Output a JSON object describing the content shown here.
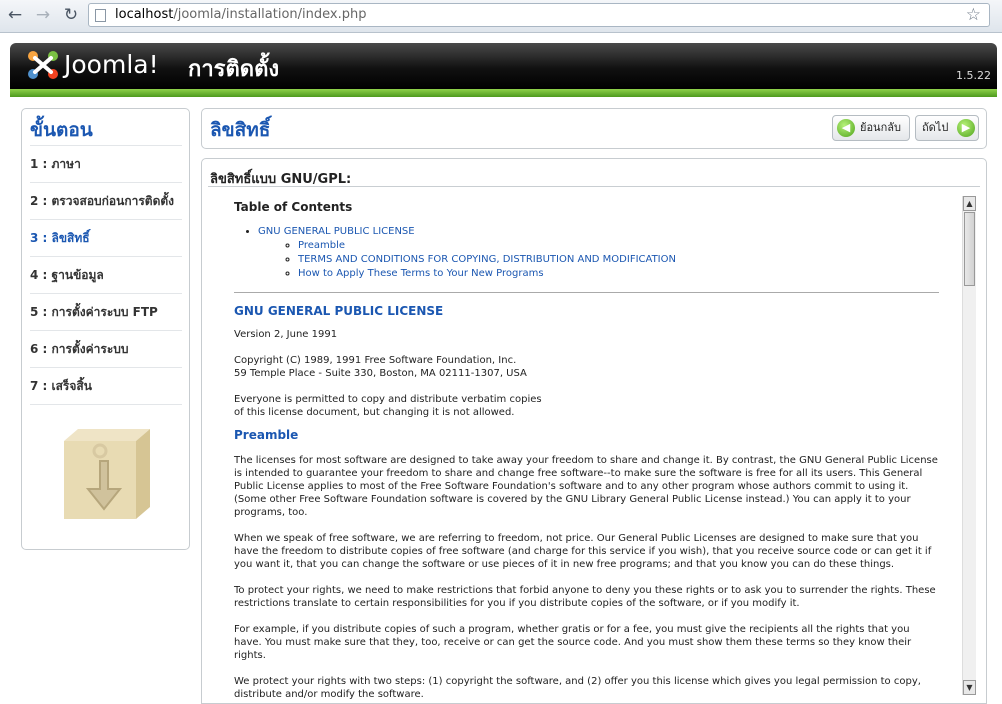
{
  "browser": {
    "back_icon": "back-arrow-icon",
    "forward_icon": "forward-arrow-icon",
    "reload_icon": "reload-icon",
    "url_host": "localhost",
    "url_path": "/joomla/installation/index.php",
    "bookmark_icon": "star-icon"
  },
  "header": {
    "logo_text": "Joomla!",
    "title": "การติดตั้ง",
    "version": "1.5.22",
    "accent_color": "#6cbf2f"
  },
  "sidebar": {
    "title": "ขั้นตอน",
    "steps": [
      {
        "label": "1 : ภาษา"
      },
      {
        "label": "2 : ตรวจสอบก่อนการติดตั้ง"
      },
      {
        "label": "3 : ลิขสิทธิ์"
      },
      {
        "label": "4 : ฐานข้อมูล"
      },
      {
        "label": "5 : การตั้งค่าระบบ FTP"
      },
      {
        "label": "6 : การตั้งค่าระบบ"
      },
      {
        "label": "7 : เสร็จสิ้น"
      }
    ]
  },
  "main": {
    "title": "ลิขสิทธิ์",
    "back_button": "ย้อนกลับ",
    "next_button": "ถัดไป",
    "panel_heading": "ลิขสิทธิ์แบบ GNU/GPL:"
  },
  "license": {
    "toc_title": "Table of Contents",
    "toc_main": "GNU GENERAL PUBLIC LICENSE",
    "toc_items": [
      "Preamble",
      "TERMS AND CONDITIONS FOR COPYING, DISTRIBUTION AND MODIFICATION",
      "How to Apply These Terms to Your New Programs"
    ],
    "heading": "GNU GENERAL PUBLIC LICENSE",
    "version": "Version 2, June 1991",
    "copyright_1": "Copyright (C) 1989, 1991 Free Software Foundation, Inc.",
    "copyright_2": "59 Temple Place - Suite 330, Boston, MA  02111-1307, USA",
    "permission_1": "Everyone is permitted to copy and distribute verbatim copies",
    "permission_2": "of this license document, but changing it is not allowed.",
    "preamble_heading": "Preamble",
    "p1": "The licenses for most software are designed to take away your freedom to share and change it. By contrast, the GNU General Public License is intended to guarantee your freedom to share and change free software--to make sure the software is free for all its users. This General Public License applies to most of the Free Software Foundation's software and to any other program whose authors commit to using it. (Some other Free Software Foundation software is covered by the GNU Library General Public License instead.) You can apply it to your programs, too.",
    "p2": "When we speak of free software, we are referring to freedom, not price. Our General Public Licenses are designed to make sure that you have the freedom to distribute copies of free software (and charge for this service if you wish), that you receive source code or can get it if you want it, that you can change the software or use pieces of it in new free programs; and that you know you can do these things.",
    "p3": "To protect your rights, we need to make restrictions that forbid anyone to deny you these rights or to ask you to surrender the rights. These restrictions translate to certain responsibilities for you if you distribute copies of the software, or if you modify it.",
    "p4": "For example, if you distribute copies of such a program, whether gratis or for a fee, you must give the recipients all the rights that you have. You must make sure that they, too, receive or can get the source code. And you must show them these terms so they know their rights.",
    "p5": "We protect your rights with two steps: (1) copyright the software, and (2) offer you this license which gives you legal permission to copy, distribute and/or modify the software."
  }
}
